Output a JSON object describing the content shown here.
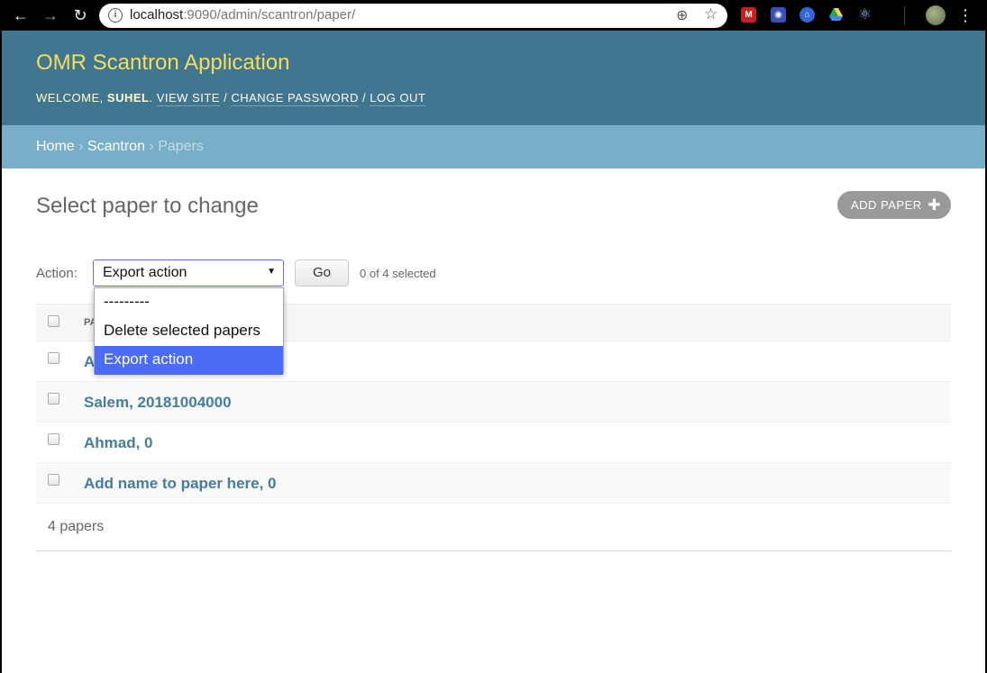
{
  "browser": {
    "url_host": "localhost",
    "url_rest": ":9090/admin/scantron/paper/",
    "icons": [
      "back-arrow-icon",
      "forward-arrow-icon",
      "reload-icon",
      "info-icon",
      "zoom-icon",
      "bookmark-star-icon",
      "gmail-icon",
      "camera-icon",
      "museum-icon",
      "drive-icon",
      "atom-icon",
      "avatar",
      "menu-icon"
    ]
  },
  "header": {
    "site_title": "OMR Scantron Application",
    "welcome": "Welcome,",
    "username": "suhel",
    "view_site": "View site",
    "change_password": "Change password",
    "log_out": "Log out"
  },
  "breadcrumbs": {
    "home": "Home",
    "app": "Scantron",
    "current": "Papers"
  },
  "content": {
    "title": "Select paper to change",
    "add_button": "Add paper"
  },
  "actions": {
    "label": "Action:",
    "selected": "Export action",
    "go": "Go",
    "counter": "0 of 4 selected",
    "options": [
      "---------",
      "Delete selected papers",
      "Export action"
    ]
  },
  "table": {
    "column_header": "Paper",
    "rows": [
      {
        "label": "A"
      },
      {
        "label": "Salem, 20181004000"
      },
      {
        "label": "Ahmad, 0"
      },
      {
        "label": "Add name to paper here, 0"
      }
    ]
  },
  "paginator": "4 papers",
  "colors": {
    "header_bg": "#417690",
    "breadcrumb_bg": "#79aec8",
    "title_yellow": "#f5dd5d",
    "link_blue": "#447e9b",
    "selected_option": "#4a6cf7"
  }
}
